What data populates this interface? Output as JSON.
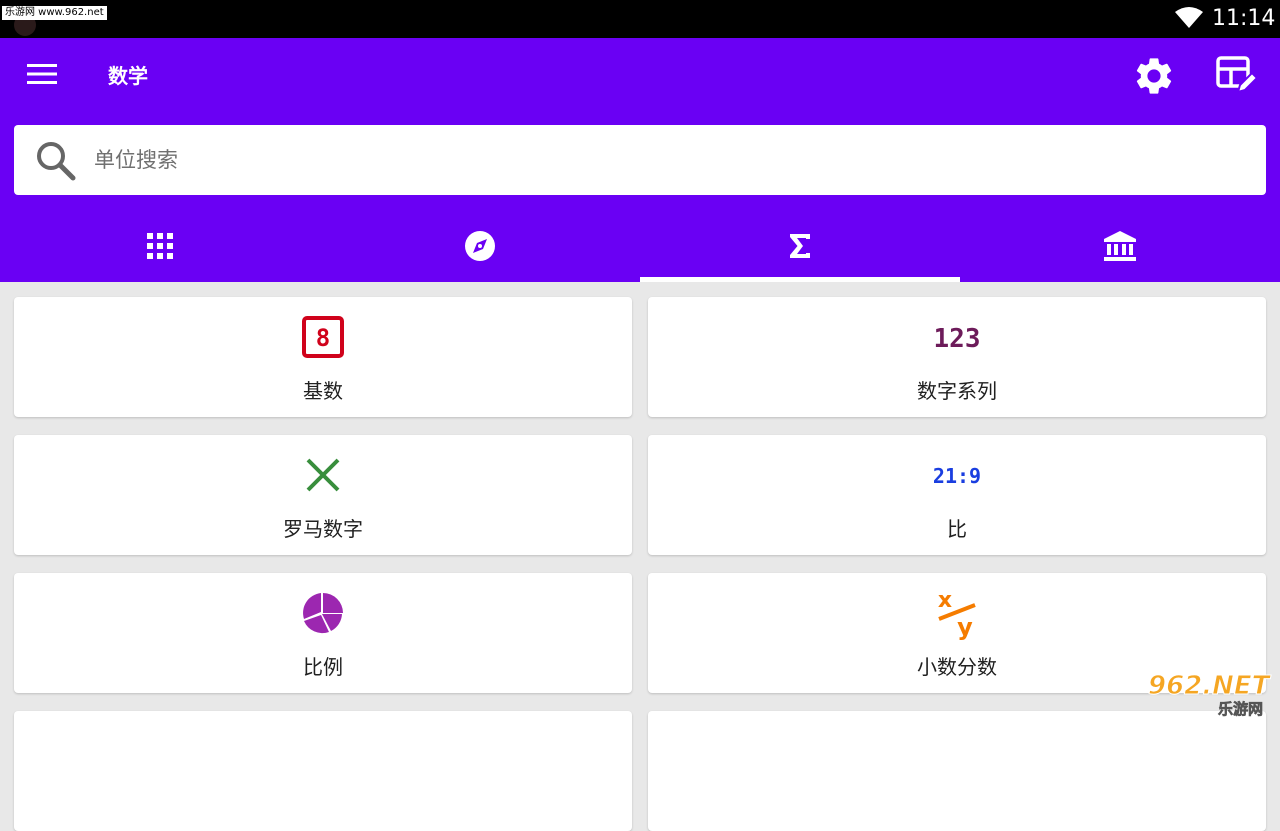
{
  "status_bar": {
    "watermark_text": "乐游网 www.962.net",
    "time": "11:14"
  },
  "app_bar": {
    "title": "数学",
    "bg_color": "#6a00f4"
  },
  "search": {
    "placeholder": "单位搜索"
  },
  "tabs": [
    {
      "icon": "grid-icon",
      "active": false
    },
    {
      "icon": "compass-icon",
      "active": false
    },
    {
      "icon": "sigma-icon",
      "active": true
    },
    {
      "icon": "bank-icon",
      "active": false
    }
  ],
  "cards": [
    {
      "label": "基数",
      "icon": "base-8-icon",
      "glyph": "8",
      "color": "#d0021b"
    },
    {
      "label": "数字系列",
      "icon": "123-icon",
      "glyph": "123",
      "color": "#6d1b5a"
    },
    {
      "label": "罗马数字",
      "icon": "roman-x-icon",
      "glyph": "X",
      "color": "#388e3c"
    },
    {
      "label": "比",
      "icon": "ratio-icon",
      "glyph": "21:9",
      "color": "#1a3ee0"
    },
    {
      "label": "比例",
      "icon": "pie-chart-icon",
      "color": "#9c27b0"
    },
    {
      "label": "小数分数",
      "icon": "fraction-icon",
      "glyph_top": "x",
      "glyph_bottom": "y",
      "color": "#f57c00"
    }
  ],
  "watermark": {
    "top": "962.NET",
    "bottom": "乐游网"
  }
}
